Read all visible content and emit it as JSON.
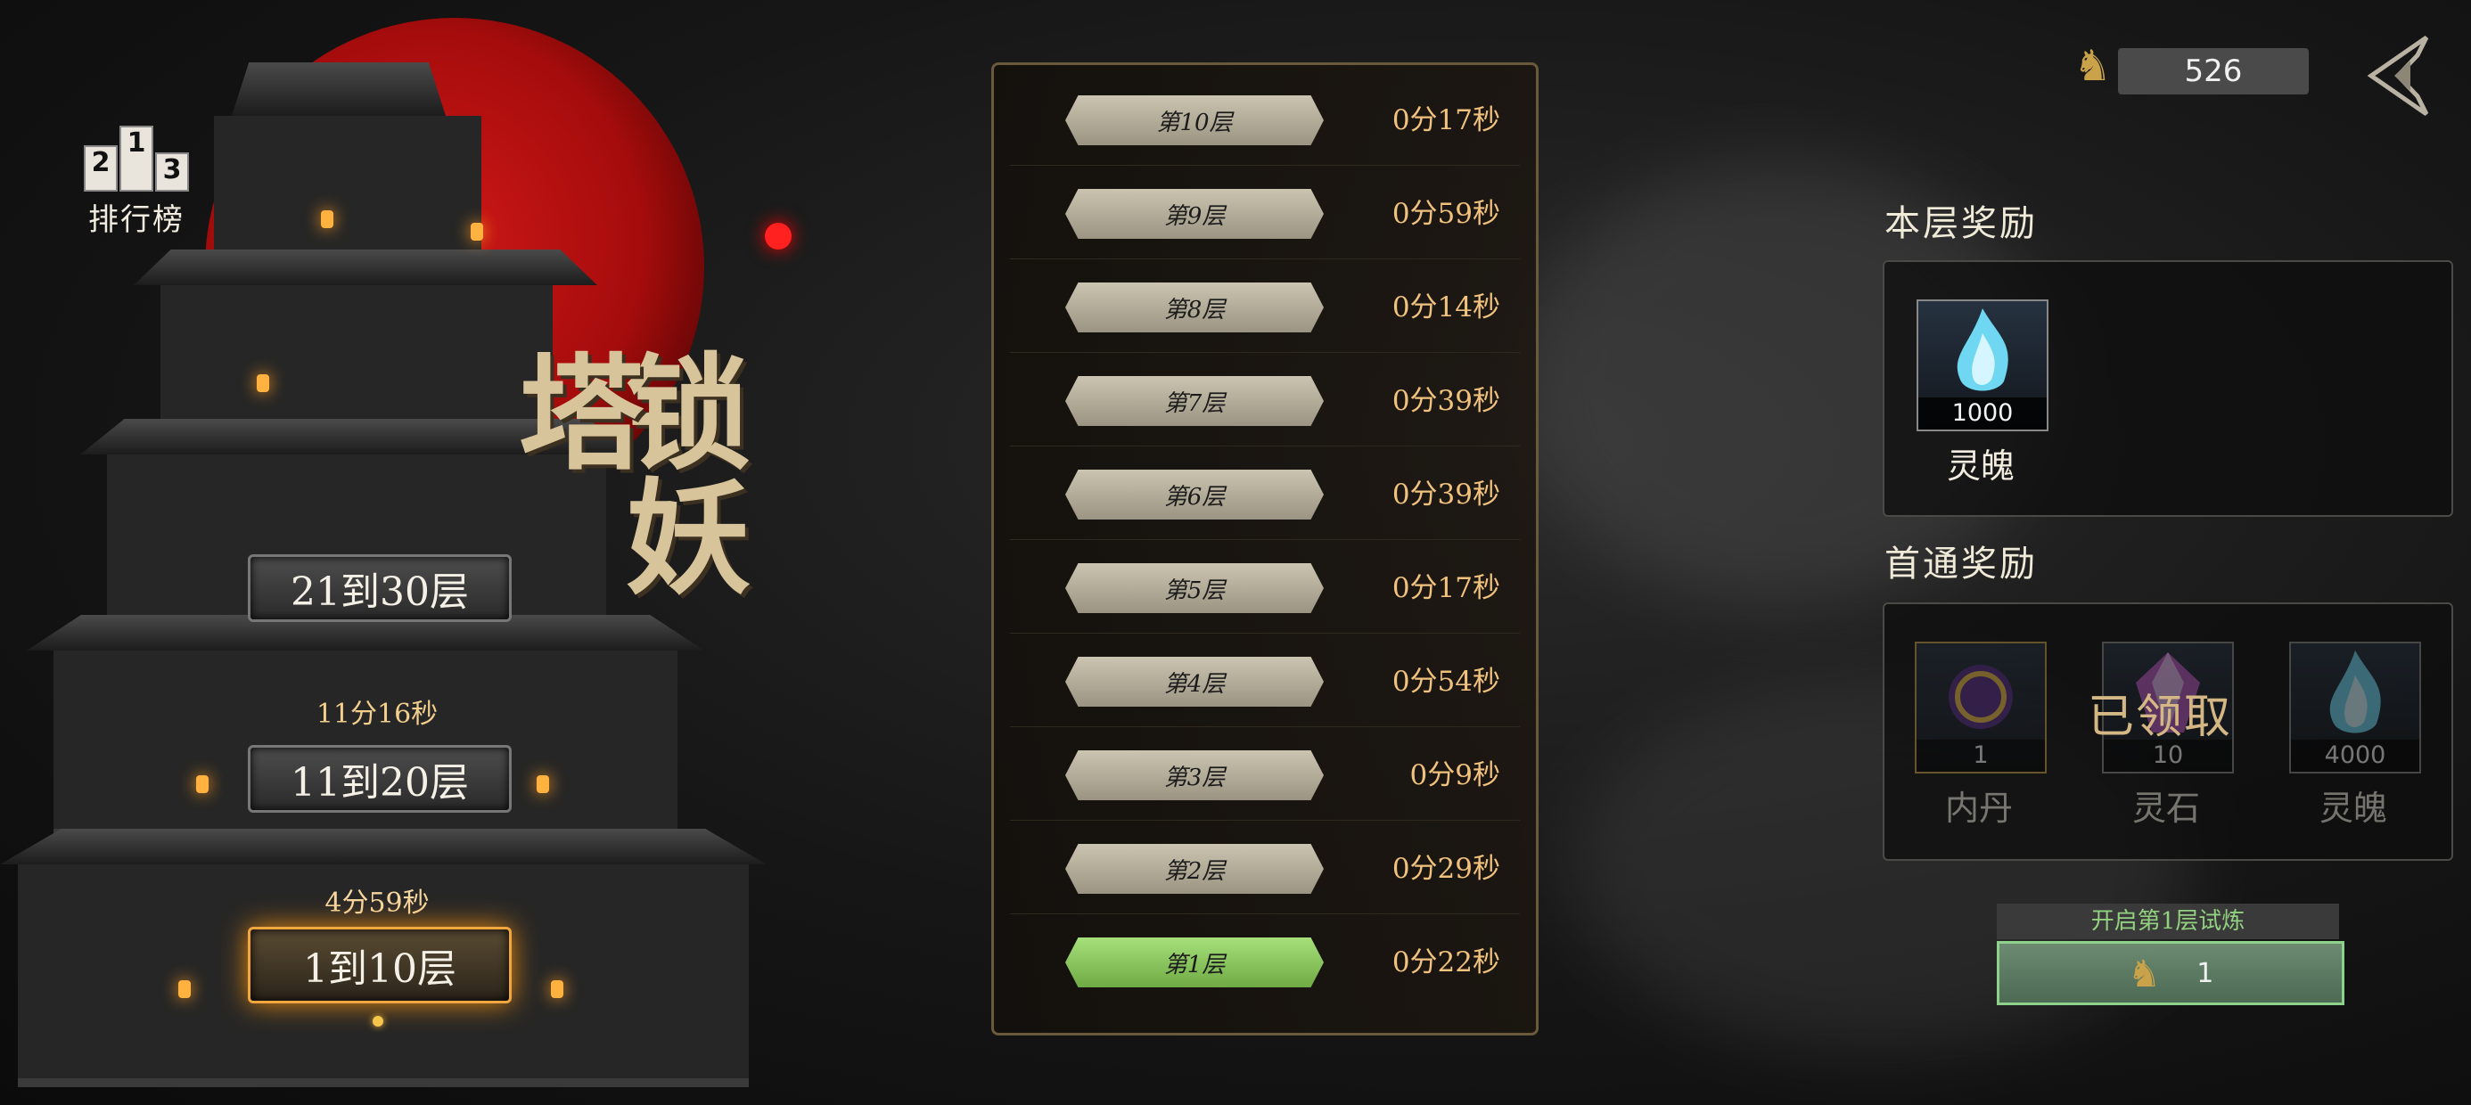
{
  "ranking": {
    "label": "排行榜",
    "podium": [
      "2",
      "1",
      "3"
    ]
  },
  "tower_title": "锁妖塔",
  "floor_ranges": [
    {
      "label": "21到30层",
      "time": "",
      "active": false
    },
    {
      "label": "11到20层",
      "time": "11分16秒",
      "active": false
    },
    {
      "label": "1到10层",
      "time": "4分59秒",
      "active": true
    }
  ],
  "levels": [
    {
      "name": "第10层",
      "time": "0分17秒",
      "current": false
    },
    {
      "name": "第9层",
      "time": "0分59秒",
      "current": false
    },
    {
      "name": "第8层",
      "time": "0分14秒",
      "current": false
    },
    {
      "name": "第7层",
      "time": "0分39秒",
      "current": false
    },
    {
      "name": "第6层",
      "time": "0分39秒",
      "current": false
    },
    {
      "name": "第5层",
      "time": "0分17秒",
      "current": false
    },
    {
      "name": "第4层",
      "time": "0分54秒",
      "current": false
    },
    {
      "name": "第3层",
      "time": "0分9秒",
      "current": false
    },
    {
      "name": "第2层",
      "time": "0分29秒",
      "current": false
    },
    {
      "name": "第1层",
      "time": "0分22秒",
      "current": true
    }
  ],
  "currency": {
    "amount": "526",
    "icon": "horse-token-icon"
  },
  "floor_reward": {
    "title": "本层奖励",
    "items": [
      {
        "name": "灵魄",
        "qty": "1000",
        "icon": "blue-flame-icon"
      }
    ]
  },
  "first_clear_reward": {
    "title": "首通奖励",
    "claimed_label": "已领取",
    "items": [
      {
        "name": "内丹",
        "qty": "1",
        "icon": "golden-orb-icon"
      },
      {
        "name": "灵石",
        "qty": "10",
        "icon": "spirit-crystal-icon"
      },
      {
        "name": "灵魄",
        "qty": "4000",
        "icon": "blue-flame-icon"
      }
    ]
  },
  "trial": {
    "label": "开启第1层试炼",
    "cost": "1",
    "icon": "horse-token-icon"
  },
  "colors": {
    "accent_gold": "#f2a640",
    "time_text": "#f1c27e",
    "current_green": "#7ed24a",
    "moon_red": "#d01818"
  }
}
